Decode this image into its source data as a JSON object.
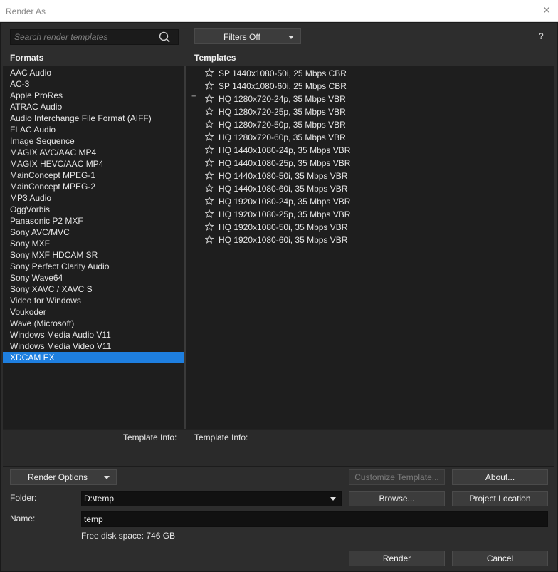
{
  "window": {
    "title": "Render As"
  },
  "search": {
    "placeholder": "Search render templates"
  },
  "filters": {
    "label": "Filters Off"
  },
  "help": {
    "label": "?"
  },
  "headers": {
    "formats": "Formats",
    "templates": "Templates"
  },
  "formats": {
    "items": [
      "AAC Audio",
      "AC-3",
      "Apple ProRes",
      "ATRAC Audio",
      "Audio Interchange File Format (AIFF)",
      "FLAC Audio",
      "Image Sequence",
      "MAGIX AVC/AAC MP4",
      "MAGIX HEVC/AAC MP4",
      "MainConcept MPEG-1",
      "MainConcept MPEG-2",
      "MP3 Audio",
      "OggVorbis",
      "Panasonic P2 MXF",
      "Sony AVC/MVC",
      "Sony MXF",
      "Sony MXF HDCAM SR",
      "Sony Perfect Clarity Audio",
      "Sony Wave64",
      "Sony XAVC / XAVC S",
      "Video for Windows",
      "Voukoder",
      "Wave (Microsoft)",
      "Windows Media Audio V11",
      "Windows Media Video V11",
      "XDCAM EX"
    ],
    "selected": "XDCAM EX"
  },
  "templates": {
    "items": [
      "SP 1440x1080-50i, 25 Mbps CBR",
      "SP 1440x1080-60i, 25 Mbps CBR",
      "HQ 1280x720-24p, 35 Mbps VBR",
      "HQ 1280x720-25p, 35 Mbps VBR",
      "HQ 1280x720-50p, 35 Mbps VBR",
      "HQ 1280x720-60p, 35 Mbps VBR",
      "HQ 1440x1080-24p, 35 Mbps VBR",
      "HQ 1440x1080-25p, 35 Mbps VBR",
      "HQ 1440x1080-50i, 35 Mbps VBR",
      "HQ 1440x1080-60i, 35 Mbps VBR",
      "HQ 1920x1080-24p, 35 Mbps VBR",
      "HQ 1920x1080-25p, 35 Mbps VBR",
      "HQ 1920x1080-50i, 35 Mbps VBR",
      "HQ 1920x1080-60i, 35 Mbps VBR"
    ],
    "drag_handle_glyph": "=",
    "star_icon": "star-outline-icon"
  },
  "template_info": {
    "left_label": "Template Info:",
    "right_label": "Template Info:"
  },
  "buttons": {
    "render_options": "Render Options",
    "customize_template": "Customize Template...",
    "about": "About...",
    "browse": "Browse...",
    "project_location": "Project Location",
    "render": "Render",
    "cancel": "Cancel"
  },
  "folder": {
    "label": "Folder:",
    "value": "D:\\temp"
  },
  "name": {
    "label": "Name:",
    "value": "temp"
  },
  "disk": {
    "text": "Free disk space: 746 GB"
  },
  "colors": {
    "selection": "#1e7fe0",
    "panel_bg": "#1e1e1e",
    "dialog_bg": "#2d2d2d"
  }
}
